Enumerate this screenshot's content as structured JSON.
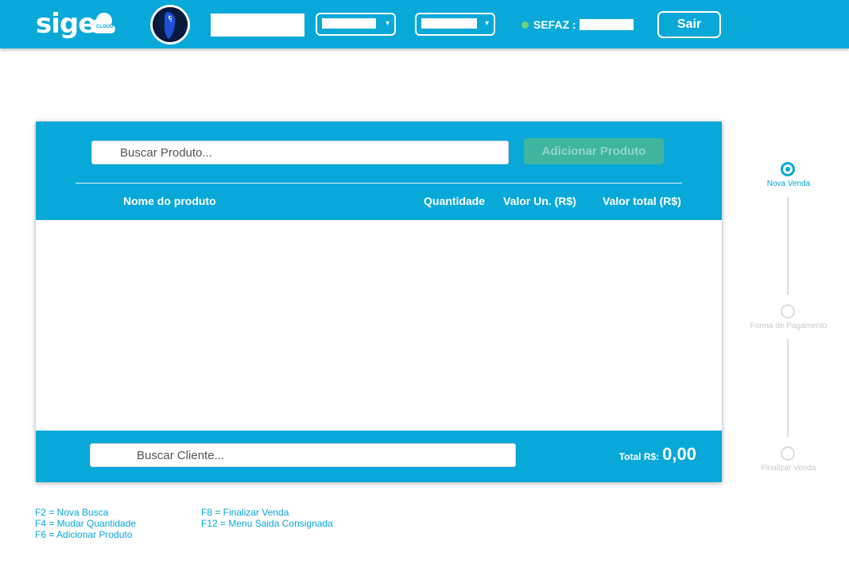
{
  "header": {
    "logo_text": "sige",
    "logo_badge": "CLOUD",
    "sefaz_label": "SEFAZ :",
    "logout_label": "Sair",
    "select_arrow": "▾"
  },
  "product_panel": {
    "search_placeholder": "Buscar Produto...",
    "add_button_label": "Adicionar Produto",
    "columns": {
      "name": "Nome do produto",
      "quantity": "Quantidade",
      "unit_value": "Valor Un. (R$)",
      "total_value": "Valor total (R$)"
    }
  },
  "footer": {
    "client_search_placeholder": "Buscar Cliente...",
    "total_label": "Total R$:",
    "total_value": "0,00"
  },
  "stepper": {
    "steps": [
      {
        "label": "Nova Venda",
        "state": "active"
      },
      {
        "label": "Forma de Pagamento",
        "state": "inactive"
      },
      {
        "label": "Finalizar Venda",
        "state": "inactive"
      }
    ]
  },
  "shortcuts": {
    "col1": [
      "F2 = Nova Busca",
      "F4 = Mudar Quantidade",
      "F6 = Adicionar Produto"
    ],
    "col2": [
      "F8 = Finalizar Venda",
      "F12 = Menu Saida Consignada"
    ]
  },
  "colors": {
    "brand": "#08a8d8",
    "add_button": "#3fb5a0",
    "status_online": "#6fd37a",
    "step_inactive": "#dcdcdc"
  },
  "icons": {
    "avatar": "avatar-image",
    "status": "status-dot-icon",
    "dropdown": "chevron-down-icon",
    "cloud": "cloud-icon"
  }
}
